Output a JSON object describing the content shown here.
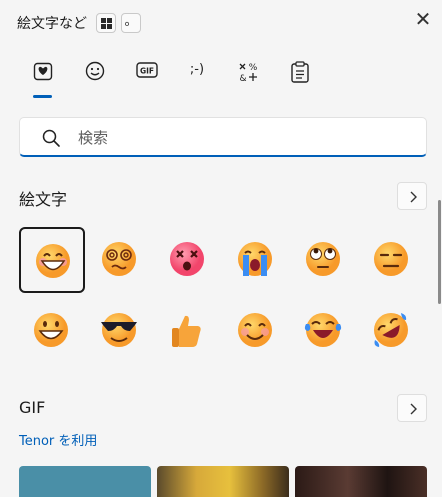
{
  "header": {
    "title": "絵文字など",
    "shortcut_key_1": "Windows",
    "shortcut_key_2": "。",
    "close_label": "✕"
  },
  "tabs": [
    {
      "name": "emoji",
      "label": ""
    },
    {
      "name": "kaomoji-smiley",
      "label": ""
    },
    {
      "name": "gif",
      "label": "GIF"
    },
    {
      "name": "kaomoji",
      "label": ";-)"
    },
    {
      "name": "symbols",
      "label": ""
    },
    {
      "name": "clipboard-history",
      "label": ""
    }
  ],
  "search": {
    "placeholder": "検索"
  },
  "emoji_section": {
    "title": "絵文字",
    "items": [
      "grinning-face-with-big-eyes",
      "face-with-spiral-eyes",
      "face-with-crossed-out-eyes",
      "loudly-crying-face",
      "face-with-rolling-eyes",
      "expressionless-face",
      "grinning-face",
      "smiling-face-with-sunglasses",
      "thumbs-up",
      "smiling-face",
      "face-with-tears-of-joy",
      "rolling-on-the-floor-laughing"
    ]
  },
  "gif_section": {
    "title": "GIF",
    "powered_by": "Tenor を利用"
  },
  "colors": {
    "accent": "#005fb8",
    "background": "#f5f5f5"
  }
}
